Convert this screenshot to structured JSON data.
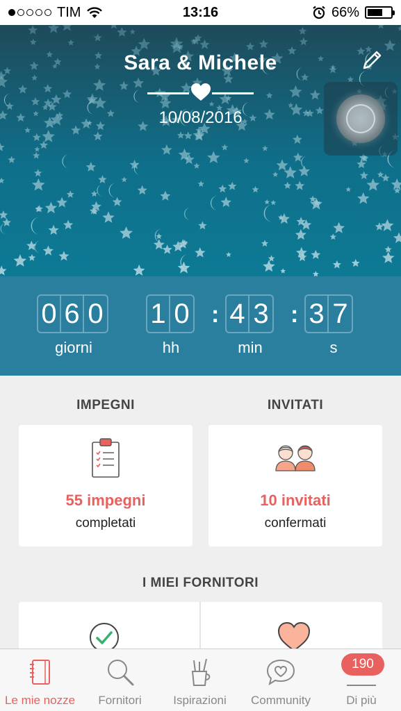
{
  "status_bar": {
    "carrier": "TIM",
    "time": "13:16",
    "battery": "66%",
    "battery_level": 0.66,
    "signal_bars": 1
  },
  "header": {
    "couple": "Sara & Michele",
    "wedding_date": "10/08/2016"
  },
  "countdown": {
    "days_digits": [
      "0",
      "6",
      "0"
    ],
    "hours_digits": [
      "1",
      "0"
    ],
    "minutes_digits": [
      "4",
      "3"
    ],
    "seconds_digits": [
      "3",
      "7"
    ],
    "labels": {
      "days": "giorni",
      "hours": "hh",
      "minutes": "min",
      "seconds": "s"
    }
  },
  "sections": {
    "tasks_title": "IMPEGNI",
    "guests_title": "INVITATI",
    "vendors_title": "I MIEI FORNITORI"
  },
  "cards": {
    "tasks": {
      "value": "55 impegni",
      "caption": "completati"
    },
    "guests": {
      "value": "10 invitati",
      "caption": "confermati"
    }
  },
  "tabbar": {
    "items": [
      {
        "label": "Le mie nozze",
        "icon": "notebook-icon",
        "active": true
      },
      {
        "label": "Fornitori",
        "icon": "search-icon",
        "active": false
      },
      {
        "label": "Ispirazioni",
        "icon": "pencil-cup-icon",
        "active": false
      },
      {
        "label": "Community",
        "icon": "chat-heart-icon",
        "active": false
      },
      {
        "label": "Di più",
        "icon": "menu-icon",
        "active": false
      }
    ],
    "badge": "190"
  },
  "colors": {
    "accent": "#e8615f",
    "countdown_bg": "#2b7f9e",
    "header_top": "#1e4a5a",
    "header_bottom": "#0d7a95"
  }
}
